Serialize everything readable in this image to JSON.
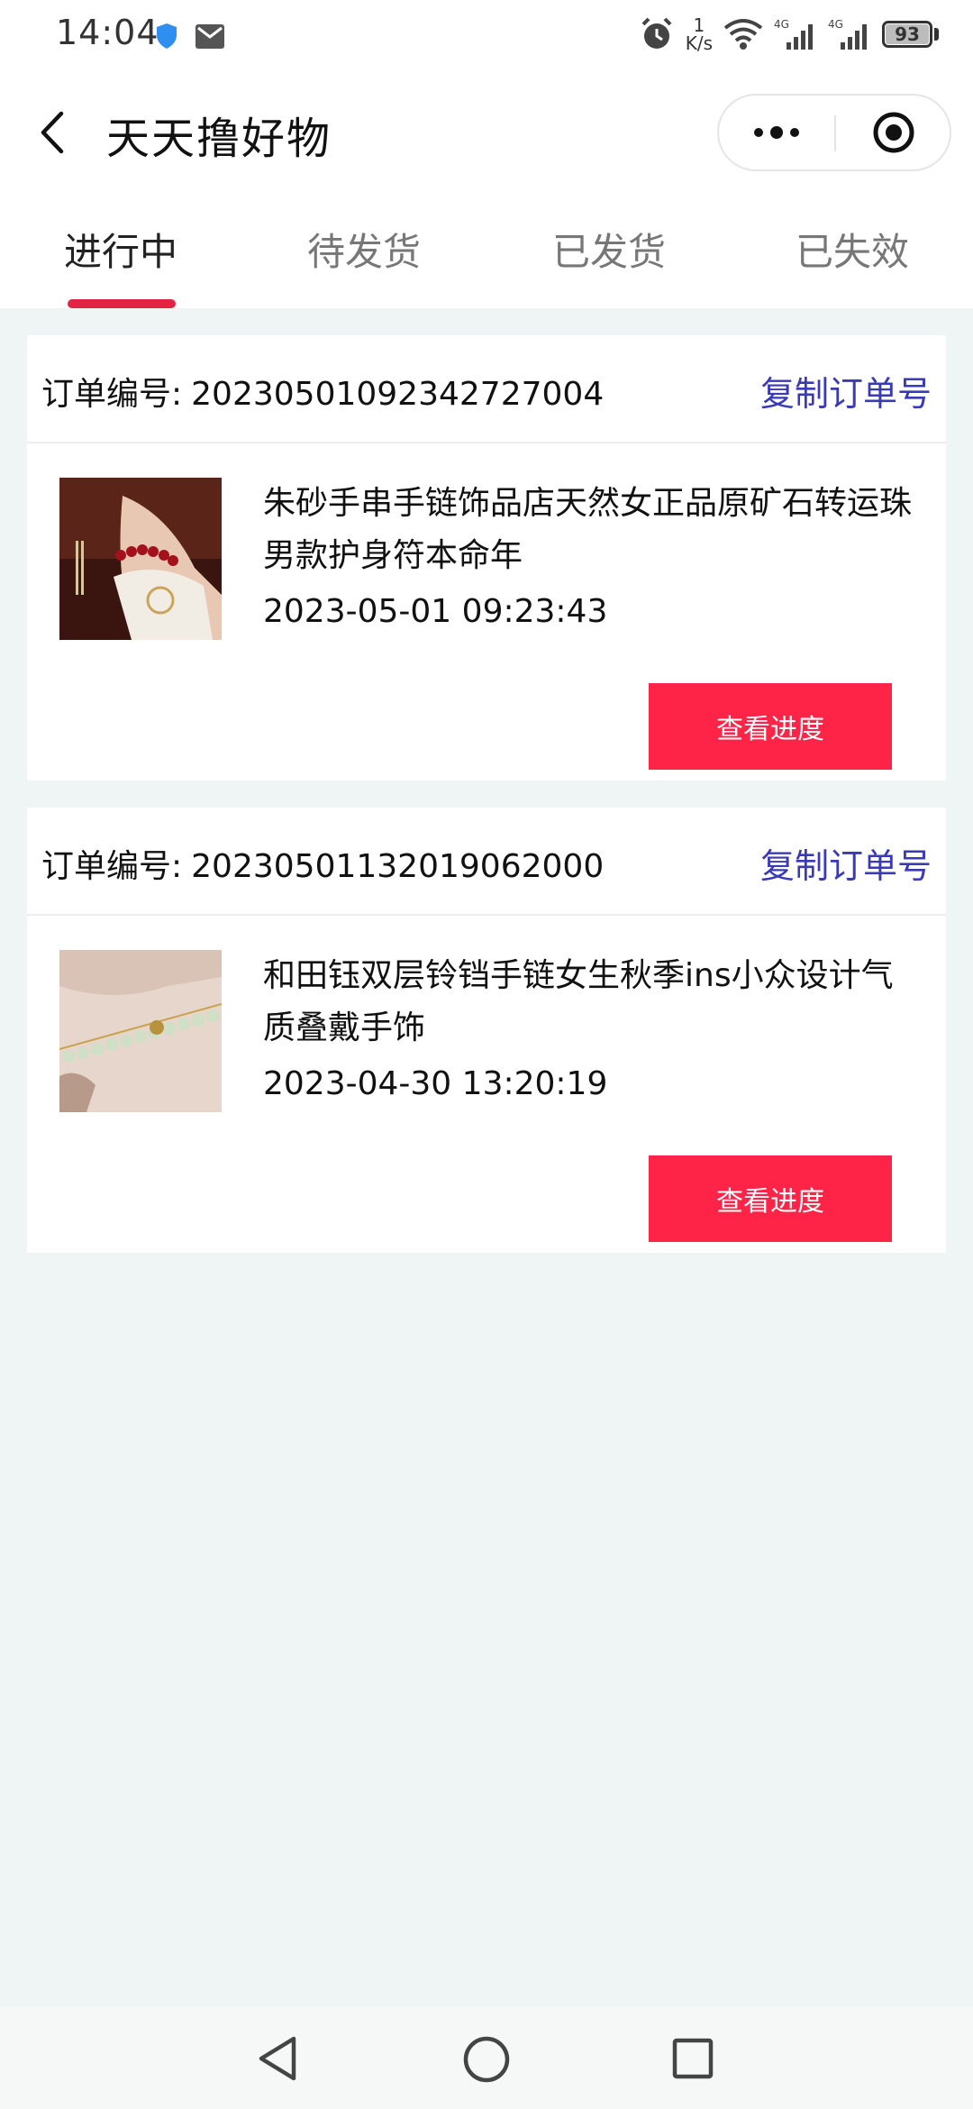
{
  "status_bar": {
    "time": "14:04",
    "speed_value": "1",
    "speed_unit": "K/s",
    "net_1": "4G",
    "net_2": "4G",
    "battery": "93"
  },
  "header": {
    "title": "天天撸好物"
  },
  "tabs": [
    {
      "label": "进行中",
      "active": true
    },
    {
      "label": "待发货",
      "active": false
    },
    {
      "label": "已发货",
      "active": false
    },
    {
      "label": "已失效",
      "active": false
    }
  ],
  "orders": [
    {
      "order_label": "订单编号:",
      "order_number": "20230501092342727004",
      "copy_label": "复制订单号",
      "product_name": "朱砂手串手链饰品店天然女正品原矿石转运珠男款护身符本命年",
      "time": "2023-05-01 09:23:43",
      "button_label": "查看进度"
    },
    {
      "order_label": "订单编号:",
      "order_number": "20230501132019062000",
      "copy_label": "复制订单号",
      "product_name": "和田钰双层铃铛手链女生秋季ins小众设计气质叠戴手饰",
      "time": "2023-04-30 13:20:19",
      "button_label": "查看进度"
    }
  ],
  "colors": {
    "accent": "#fe2447",
    "tab_indicator": "#e32244",
    "link": "#3a3ab8",
    "background": "#eff4f4"
  }
}
